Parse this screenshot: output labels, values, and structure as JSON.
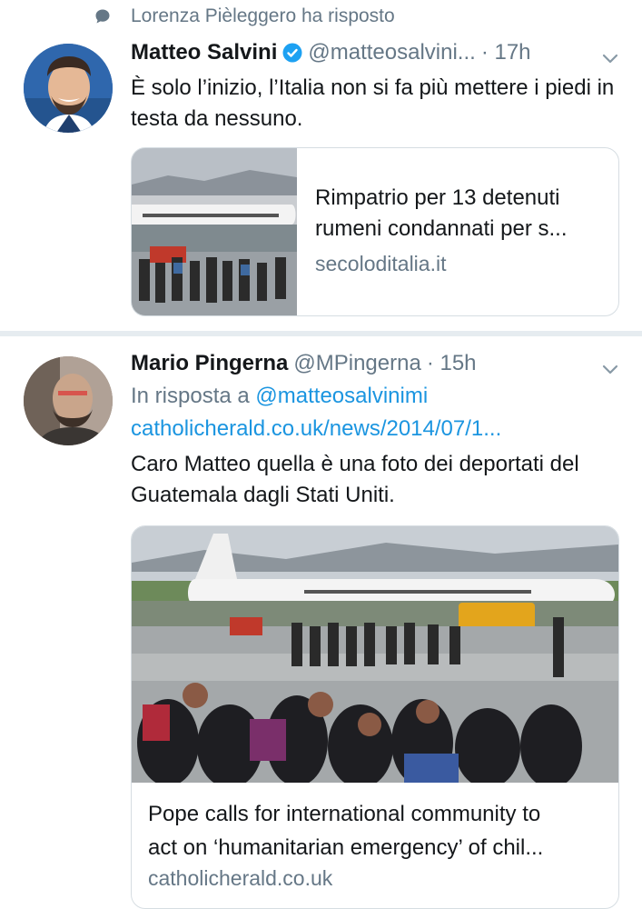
{
  "retweet_context": {
    "text": "Lorenza Pièleggero ha risposto",
    "icon": "speech-bubble-icon"
  },
  "tweets": [
    {
      "name": "Matteo Salvini",
      "handle": "@matteosalvini...",
      "time": "· 17h",
      "verified": true,
      "text": "È solo l’inizio, l’Italia non si fa più mettere i piedi in testa da nessuno.",
      "card": {
        "title_line1": "Rimpatrio per 13 detenuti",
        "title_line2": "rumeni condannati per s...",
        "domain": "secoloditalia.it"
      }
    },
    {
      "name": "Mario Pingerna",
      "handle": "@MPingerna",
      "time": "· 15h",
      "reply_prefix": "In risposta a",
      "reply_to": "@matteosalvinimi",
      "link": "catholicherald.co.uk/news/2014/07/1...",
      "text": "Caro Matteo quella è una foto dei deportati del Guatemala dagli Stati Uniti.",
      "card": {
        "title_line1": "Pope calls for international community to",
        "title_line2": "act on ‘humanitarian emergency’ of chil...",
        "domain": "catholicherald.co.uk"
      }
    }
  ],
  "colors": {
    "link": "#1b95e0",
    "secondary": "#657786",
    "verified": "#1da1f2",
    "separator": "#e6ecf0"
  }
}
